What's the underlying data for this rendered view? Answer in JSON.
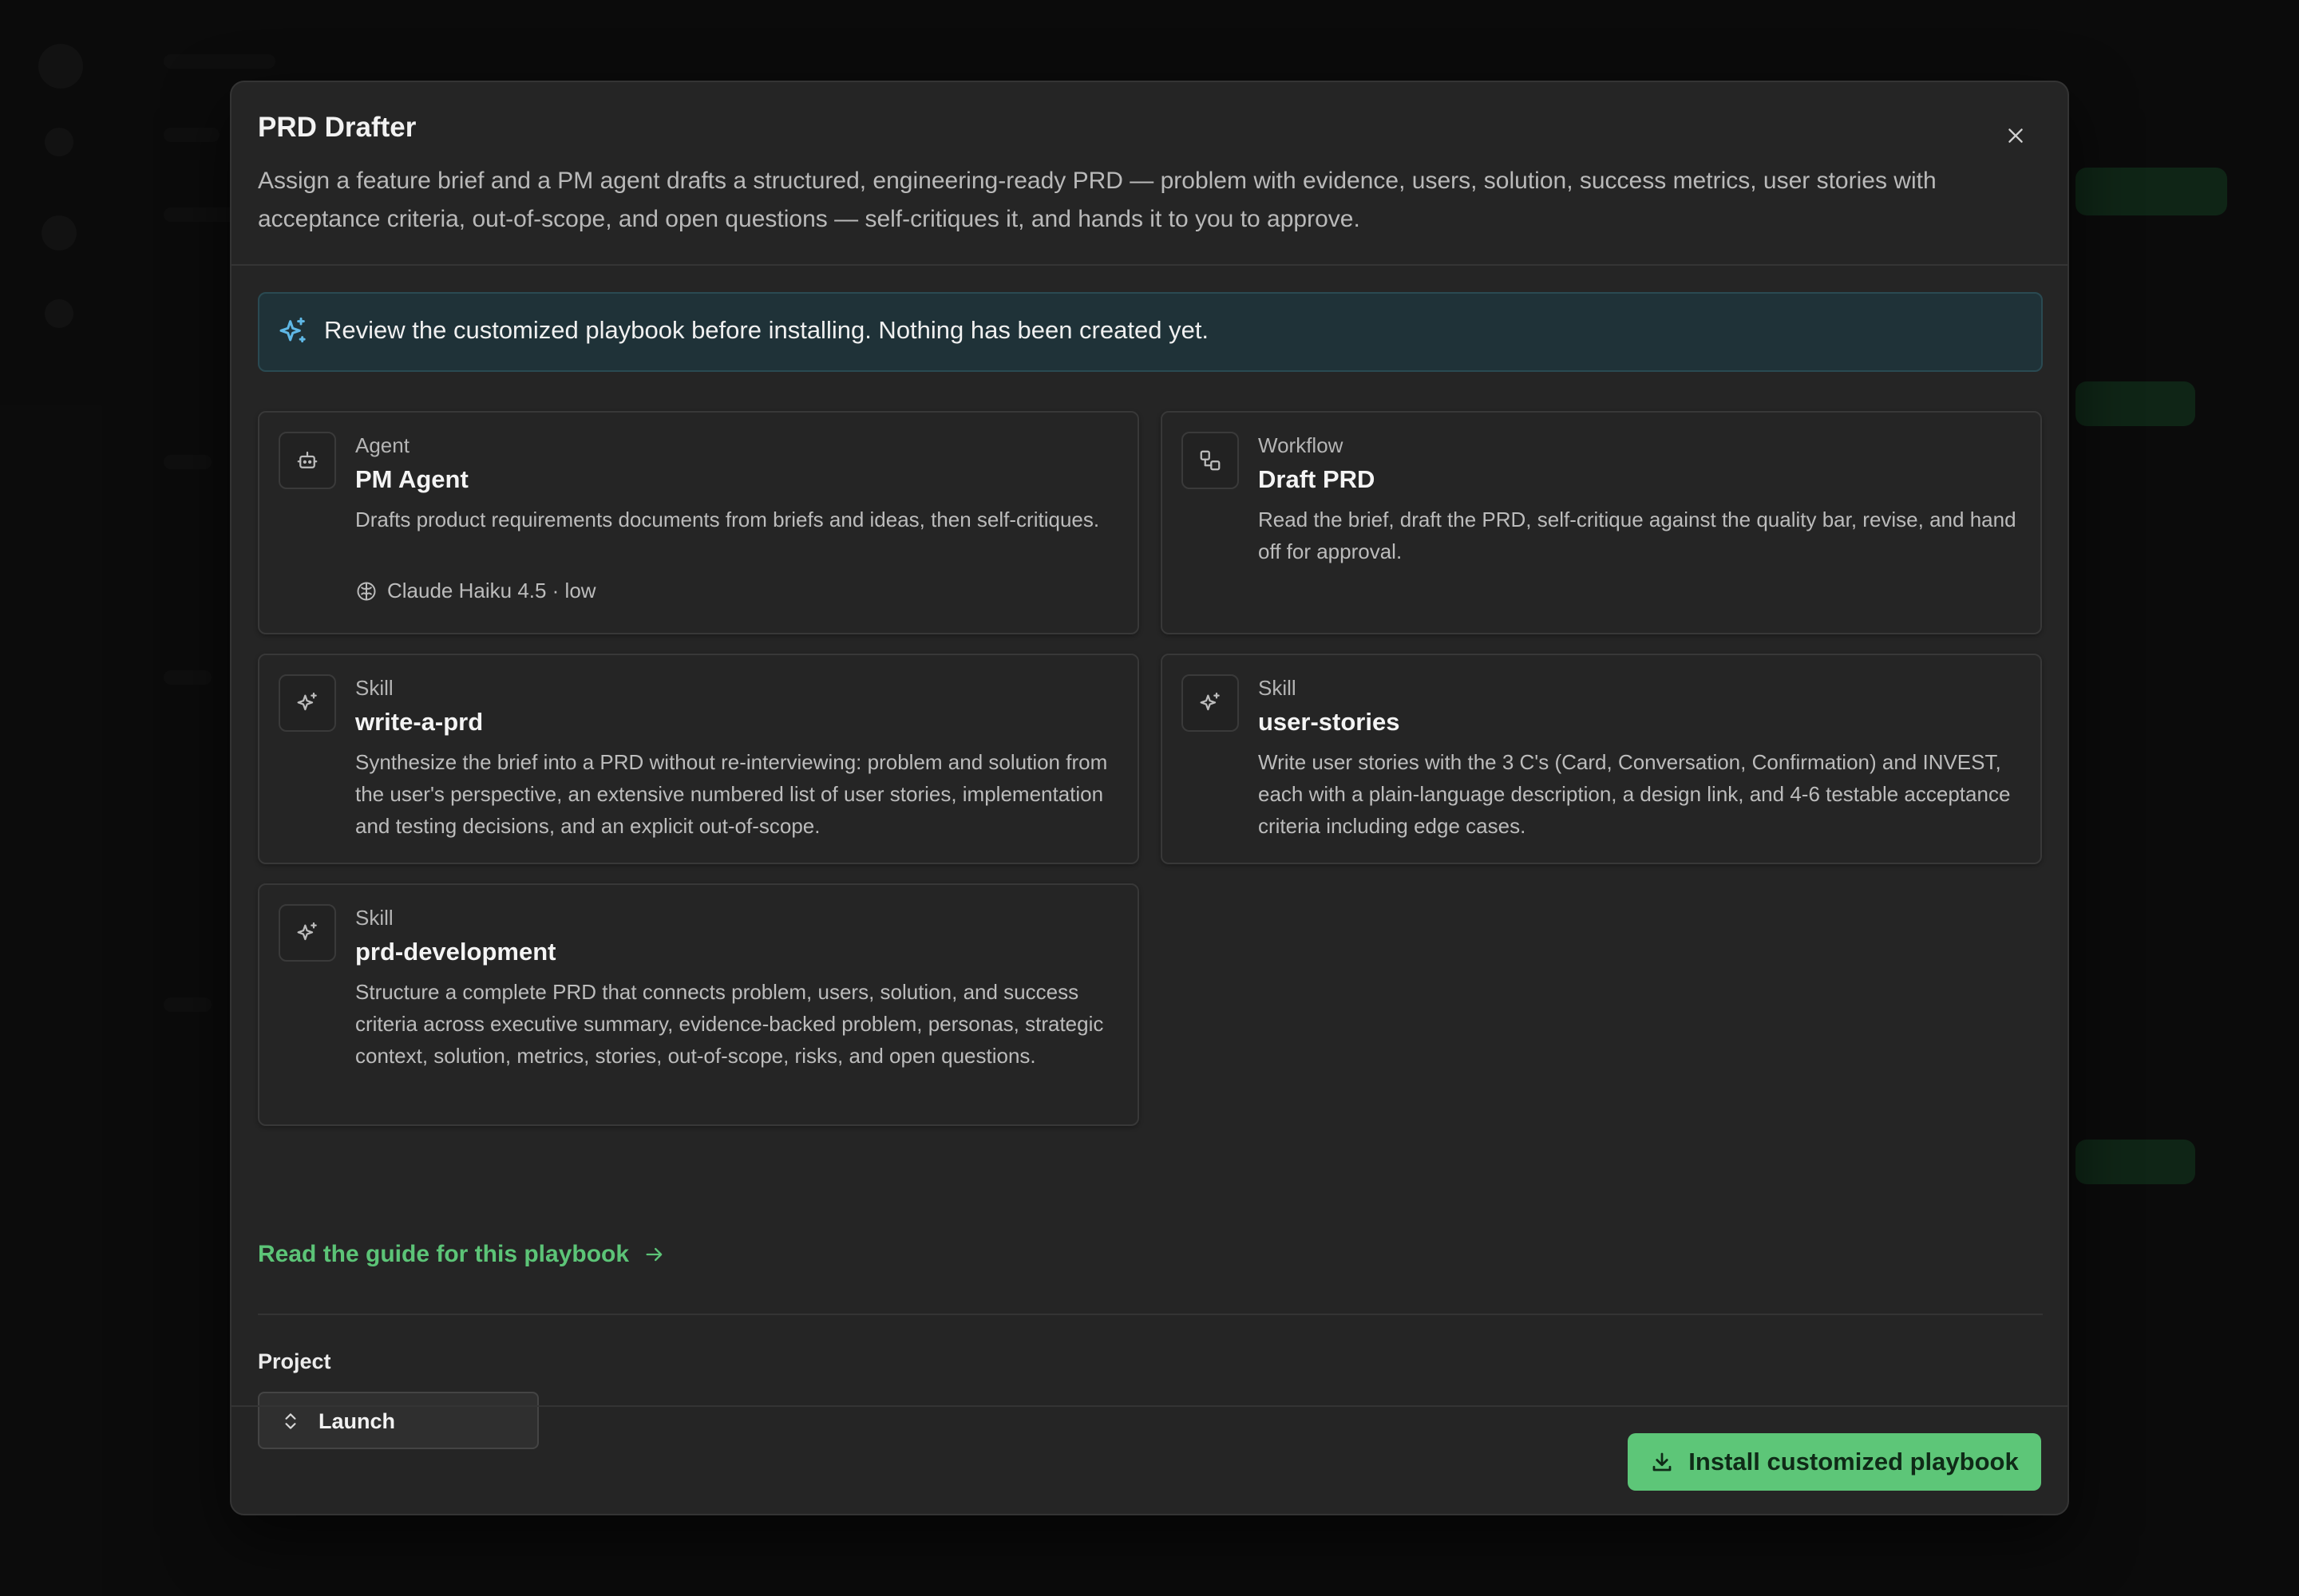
{
  "modal": {
    "title": "PRD Drafter",
    "description": "Assign a feature brief and a PM agent drafts a structured, engineering-ready PRD — problem with evidence, users, solution, success metrics, user stories with acceptance criteria, out-of-scope, and open questions — self-critiques it, and hands it to you to approve.",
    "close_icon": "close-icon"
  },
  "notice": {
    "icon": "sparkles-icon",
    "text": "Review the customized playbook before installing. Nothing has been created yet."
  },
  "cards": [
    {
      "kind": "Agent",
      "name": "PM Agent",
      "icon": "robot-icon",
      "description": "Drafts product requirements documents from briefs and ideas, then self-critiques.",
      "meta_icon": "brain-icon",
      "meta": "Claude Haiku 4.5 · low"
    },
    {
      "kind": "Workflow",
      "name": "Draft PRD",
      "icon": "workflow-icon",
      "description": "Read the brief, draft the PRD, self-critique against the quality bar, revise, and hand off for approval."
    },
    {
      "kind": "Skill",
      "name": "write-a-prd",
      "icon": "sparkles-icon",
      "description": "Synthesize the brief into a PRD without re-interviewing: problem and solution from the user's perspective, an extensive numbered list of user stories, implementation and testing decisions, and an explicit out-of-scope."
    },
    {
      "kind": "Skill",
      "name": "user-stories",
      "icon": "sparkles-icon",
      "description": "Write user stories with the 3 C's (Card, Conversation, Confirmation) and INVEST, each with a plain-language description, a design link, and 4-6 testable acceptance criteria including edge cases."
    },
    {
      "kind": "Skill",
      "name": "prd-development",
      "icon": "sparkles-icon",
      "description": "Structure a complete PRD that connects problem, users, solution, and success criteria across executive summary, evidence-backed problem, personas, strategic context, solution, metrics, stories, out-of-scope, risks, and open questions."
    }
  ],
  "guide_link": {
    "label": "Read the guide for this playbook",
    "icon": "arrow-right-icon"
  },
  "project": {
    "label": "Project",
    "value": "Launch",
    "icon": "chevron-up-down-icon"
  },
  "install_button": {
    "label": "Install customized playbook",
    "icon": "download-icon"
  },
  "colors": {
    "accent": "#5dc678",
    "link": "#5cc477",
    "notice_bg": "#1f3238",
    "modal_bg": "#252525"
  }
}
